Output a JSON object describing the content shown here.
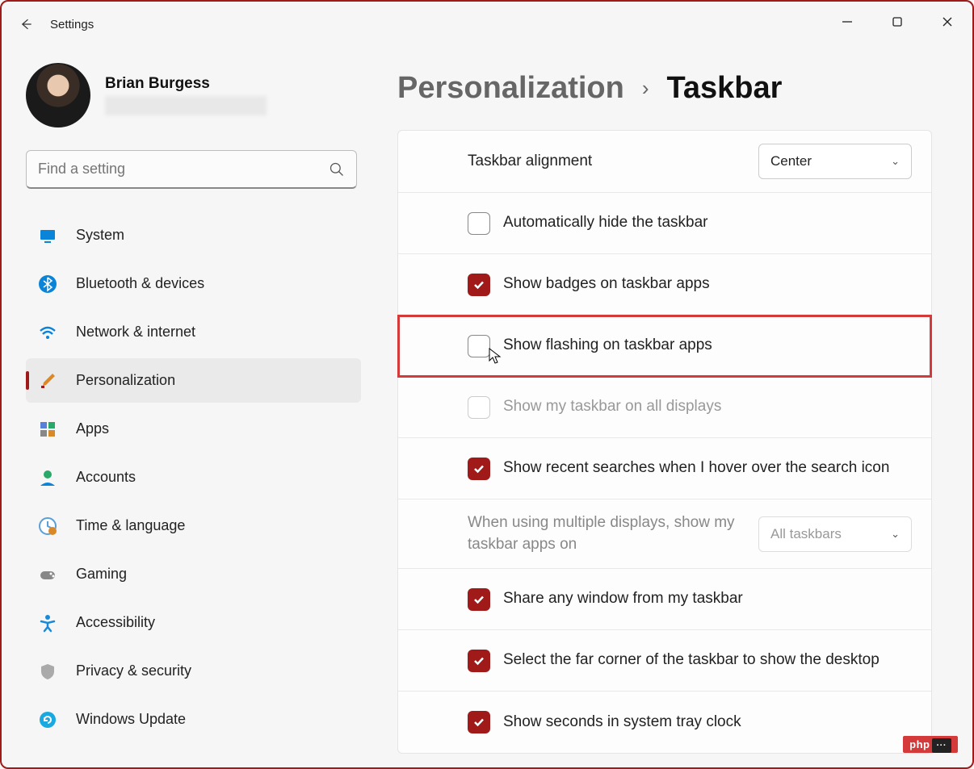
{
  "window": {
    "title": "Settings"
  },
  "user": {
    "name": "Brian Burgess"
  },
  "search": {
    "placeholder": "Find a setting"
  },
  "sidebar": {
    "items": [
      {
        "label": "System",
        "icon": "monitor-icon",
        "color": "#0a84d8"
      },
      {
        "label": "Bluetooth & devices",
        "icon": "bluetooth-icon",
        "color": "#0a84d8"
      },
      {
        "label": "Network & internet",
        "icon": "wifi-icon",
        "color": "#0a84d8"
      },
      {
        "label": "Personalization",
        "icon": "brush-icon",
        "color": "#d88a2a",
        "selected": true
      },
      {
        "label": "Apps",
        "icon": "apps-icon",
        "color": "#5a7fd8"
      },
      {
        "label": "Accounts",
        "icon": "person-icon",
        "color": "#2aa86a"
      },
      {
        "label": "Time & language",
        "icon": "clock-globe-icon",
        "color": "#5a9fd8"
      },
      {
        "label": "Gaming",
        "icon": "gamepad-icon",
        "color": "#888"
      },
      {
        "label": "Accessibility",
        "icon": "accessibility-icon",
        "color": "#1a8ad8"
      },
      {
        "label": "Privacy & security",
        "icon": "shield-icon",
        "color": "#888"
      },
      {
        "label": "Windows Update",
        "icon": "update-icon",
        "color": "#1aa8e0"
      }
    ]
  },
  "breadcrumb": {
    "parent": "Personalization",
    "current": "Taskbar"
  },
  "settings": {
    "alignment": {
      "label": "Taskbar alignment",
      "value": "Center"
    },
    "autohide": {
      "label": "Automatically hide the taskbar",
      "checked": false
    },
    "badges": {
      "label": "Show badges on taskbar apps",
      "checked": true
    },
    "flashing": {
      "label": "Show flashing on taskbar apps",
      "checked": false,
      "highlight": true
    },
    "alldisplays": {
      "label": "Show my taskbar on all displays",
      "checked": false,
      "disabled": true
    },
    "recentsearch": {
      "label": "Show recent searches when I hover over the search icon",
      "checked": true
    },
    "multidisplay": {
      "label": "When using multiple displays, show my taskbar apps on",
      "value": "All taskbars",
      "disabled": true
    },
    "shareany": {
      "label": "Share any window from my taskbar",
      "checked": true
    },
    "farcorner": {
      "label": "Select the far corner of the taskbar to show the desktop",
      "checked": true
    },
    "seconds": {
      "label": "Show seconds in system tray clock",
      "checked": true
    }
  },
  "accent_color": "#a11a1a",
  "watermark": "php"
}
